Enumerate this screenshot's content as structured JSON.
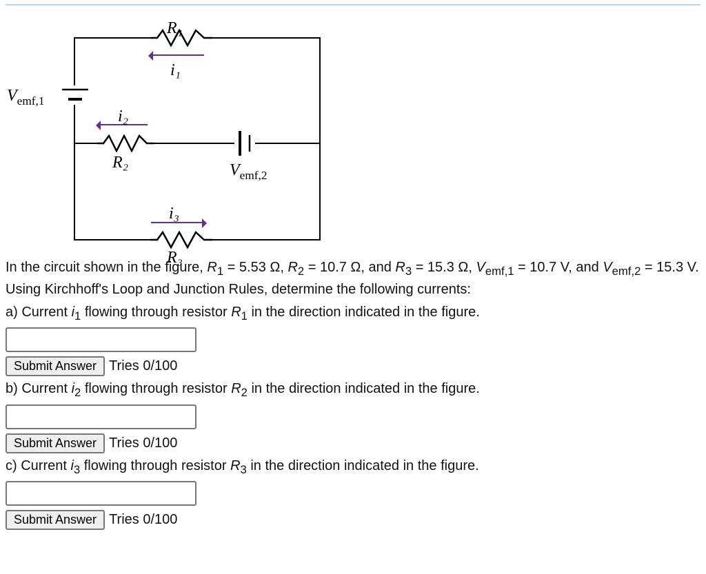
{
  "circuit": {
    "R1_label": "R₁",
    "R2_label": "R₂",
    "R3_label": "R₃",
    "i1_label": "i₁",
    "i2_label": "i₂",
    "i3_label": "i₃",
    "Vemf1_label_pre": "V",
    "Vemf1_label_sub": "emf,1",
    "Vemf2_label_pre": "V",
    "Vemf2_label_sub": "emf,2"
  },
  "problem": {
    "text": "In the circuit shown in the figure, R₁ = 5.53 Ω, R₂ = 10.7 Ω, and R₃ = 15.3 Ω, Vₑₘ𝒻,₁ = 10.7 V, and Vₑₘ𝒻,₂ = 15.3 V. Using Kirchhoff's Loop and Junction Rules, determine the following currents:",
    "part_a": "a) Current i₁ flowing through resistor R₁ in the direction indicated in the figure.",
    "part_b": "b) Current i₂ flowing through resistor R₂ in the direction indicated in the figure.",
    "part_c": "c) Current i₃ flowing through resistor R₃ in the direction indicated in the figure.",
    "R1": 5.53,
    "R2": 10.7,
    "R3": 15.3,
    "Vemf1": 10.7,
    "Vemf2": 15.3
  },
  "controls": {
    "submit_label": "Submit Answer",
    "tries_a": "Tries 0/100",
    "tries_b": "Tries 0/100",
    "tries_c": "Tries 0/100"
  }
}
